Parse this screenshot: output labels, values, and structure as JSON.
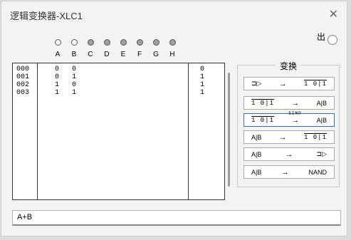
{
  "window": {
    "title": "逻辑变换器-XLC1"
  },
  "output_label": "出",
  "inputs": [
    {
      "label": "A",
      "state": "open"
    },
    {
      "label": "B",
      "state": "open"
    },
    {
      "label": "C",
      "state": "filled"
    },
    {
      "label": "D",
      "state": "filled"
    },
    {
      "label": "E",
      "state": "filled"
    },
    {
      "label": "F",
      "state": "filled"
    },
    {
      "label": "G",
      "state": "filled"
    },
    {
      "label": "H",
      "state": "filled"
    }
  ],
  "truth_table": {
    "rows": [
      {
        "index": "000",
        "a": "0",
        "b": "0",
        "out": "0"
      },
      {
        "index": "001",
        "a": "0",
        "b": "1",
        "out": "1"
      },
      {
        "index": "002",
        "a": "1",
        "b": "0",
        "out": "1"
      },
      {
        "index": "003",
        "a": "1",
        "b": "1",
        "out": "1"
      }
    ]
  },
  "conversion": {
    "title": "变换",
    "buttons": [
      {
        "left": "⊐▷",
        "mid": "→",
        "right": "1̄0̄|1̄"
      },
      {
        "left": "1̄0̄|1̄",
        "mid": "→",
        "right": "A|B"
      },
      {
        "left": "1̄0̄|1̄",
        "mid": "SIMP",
        "right": "A|B"
      },
      {
        "left": "A|B",
        "mid": "→",
        "right": "1̄0̄|1̄"
      },
      {
        "left": "A|B",
        "mid": "→",
        "right": "⊐▷"
      },
      {
        "left": "A|B",
        "mid": "→",
        "right": "NAND"
      }
    ]
  },
  "expression": "A+B",
  "colors": {
    "accent": "#2f6fd0",
    "window": "#f3f3f3"
  }
}
